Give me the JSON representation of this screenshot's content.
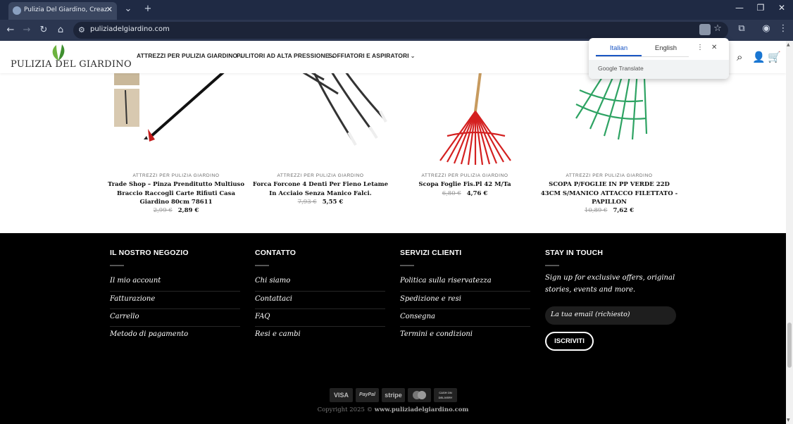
{
  "browser": {
    "tab_title": "Pulizia Del Giardino, Creazione",
    "url": "puliziadelgiardino.com"
  },
  "header": {
    "logo_text": "PULIZIA DEL GIARDINO",
    "nav": [
      {
        "label": "ATTREZZI PER PULIZIA GIARDINO"
      },
      {
        "label": "PULITORI AD ALTA PRESSIONE"
      },
      {
        "label": "SOFFIATORI E ASPIRATORI"
      }
    ]
  },
  "translate_popup": {
    "lang_source": "Italian",
    "lang_target": "English",
    "footer": "Google Translate"
  },
  "products": [
    {
      "category": "ATTREZZI PER PULIZIA GIARDINO",
      "name": "Trade Shop – Pinza Prenditutto Multiuso Braccio Raccogli Carte Rifiuti Casa Giardino 80cm 78611",
      "price_old": "2,99 €",
      "price_new": "2,89 €"
    },
    {
      "category": "ATTREZZI PER PULIZIA GIARDINO",
      "name": "Forca Forcone 4 Denti Per Fieno Letame In Acciaio Senza Manico Falci.",
      "price_old": "7,93 €",
      "price_new": "5,55 €"
    },
    {
      "category": "ATTREZZI PER PULIZIA GIARDINO",
      "name": "Scopa Foglie Fis.Pl 42 M/Ta",
      "price_old": "6,80 €",
      "price_new": "4,76 €"
    },
    {
      "category": "ATTREZZI PER PULIZIA GIARDINO",
      "name": "SCOPA P/FOGLIE IN PP VERDE 22D 43CM S/MANICO ATTACCO FILETTATO - PAPILLON",
      "price_old": "10,89 €",
      "price_new": "7,62 €"
    }
  ],
  "footer": {
    "col1": {
      "title": "IL NOSTRO NEGOZIO",
      "links": [
        "Il mio account",
        "Fatturazione",
        "Carrello",
        "Metodo di pagamento"
      ]
    },
    "col2": {
      "title": "CONTATTO",
      "links": [
        "Chi siamo",
        "Contattaci",
        "FAQ",
        "Resi e cambi"
      ]
    },
    "col3": {
      "title": "SERVIZI CLIENTI",
      "links": [
        "Politica sulla riservatezza",
        "Spedizione e resi",
        "Consegna",
        "Termini e condizioni"
      ]
    },
    "col4": {
      "title": "STAY IN TOUCH",
      "text": "Sign up for exclusive offers, original stories, events and more.",
      "email_placeholder": "La tua email (richiesto)",
      "button": "ISCRIVITI"
    },
    "payments": [
      "VISA",
      "PayPal",
      "stripe",
      "mastercard",
      "CASH ON DELIVERY"
    ],
    "copyright_prefix": "Copyright 2025 ©",
    "copyright_site": "www.puliziadelgiardino.com"
  }
}
